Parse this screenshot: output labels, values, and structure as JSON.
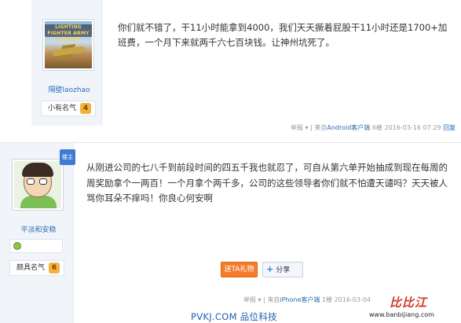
{
  "post1": {
    "game_title": "LIGHTING FIGHTER ARMY FIGHTER",
    "username": "隔壁laozhao",
    "rank_label": "小有名气",
    "rank_level": "4",
    "content": "你们就不错了，干11小时能拿到4000，我们天天撅着屁股干11小时还是1700+加班费，一个月下来就两千六七百块钱。让神州坑死了。",
    "meta": {
      "report": "举报",
      "report_arrow": "▾",
      "via_prefix": "| 来自",
      "via_client": "Android客户端",
      "floor": "6楼",
      "timestamp": "2016-03-16 07:29",
      "reply": "回复"
    }
  },
  "post2": {
    "corner_badge": "楼主",
    "username": "平淡和安稳",
    "rank_label": "颇具名气",
    "rank_level": "6",
    "content": "从刚进公司的七八千到前段时间的四五千我也就忍了，可自从第六单开始抽成到现在每周的周奖励拿个一两百！一个月拿个两千多，公司的这些领导者你们就不怕遭天谴吗？天天被人骂你耳朵不痒吗！你良心何安啊",
    "gift_button": "送TA礼物",
    "share_icon": "+",
    "share_button": "分享",
    "meta": {
      "report": "举报",
      "report_arrow": "▾",
      "via_prefix": "| 来自",
      "via_client": "iPhone客户端",
      "floor": "1楼",
      "timestamp": "2016-03-04"
    }
  },
  "watermarks": {
    "bottom": "PVKJ.COM 品位科技",
    "site_red": "比比江",
    "site_url": "www.banbijiang.com"
  },
  "colors": {
    "link_blue": "#2a6db6",
    "gift_orange": "#f47d2d",
    "sidebar_bg": "#f1f5fa",
    "watermark_red": "#d23a2a"
  },
  "icons": {
    "rank_badge": "shield-icon",
    "medal": "medal-icon",
    "share": "plus-icon"
  }
}
